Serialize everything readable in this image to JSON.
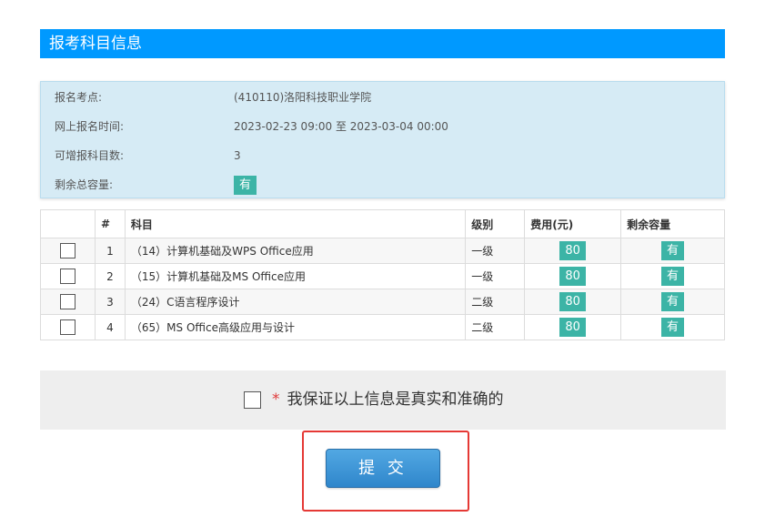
{
  "section": {
    "title": "报考科目信息"
  },
  "info": {
    "site_label": "报名考点:",
    "site_value": "(410110)洛阳科技职业学院",
    "time_label": "网上报名时间:",
    "time_value": "2023-02-23 09:00 至 2023-03-04 00:00",
    "count_label": "可增报科目数:",
    "count_value": "3",
    "capacity_label": "剩余总容量:",
    "capacity_value": "有"
  },
  "table": {
    "headers": [
      "",
      "#",
      "科目",
      "级别",
      "费用(元)",
      "剩余容量"
    ],
    "rows": [
      {
        "num": "1",
        "subject": "（14）计算机基础及WPS Office应用",
        "level": "一级",
        "fee": "80",
        "capacity": "有"
      },
      {
        "num": "2",
        "subject": "（15）计算机基础及MS Office应用",
        "level": "一级",
        "fee": "80",
        "capacity": "有"
      },
      {
        "num": "3",
        "subject": "（24）C语言程序设计",
        "level": "二级",
        "fee": "80",
        "capacity": "有"
      },
      {
        "num": "4",
        "subject": "（65）MS Office高级应用与设计",
        "level": "二级",
        "fee": "80",
        "capacity": "有"
      }
    ]
  },
  "confirm": {
    "star": "*",
    "text": "我保证以上信息是真实和准确的"
  },
  "submit": {
    "label": "提 交"
  },
  "colors": {
    "accent": "#0099ff",
    "badge": "#3cb4a6",
    "highlight": "#e53935"
  }
}
